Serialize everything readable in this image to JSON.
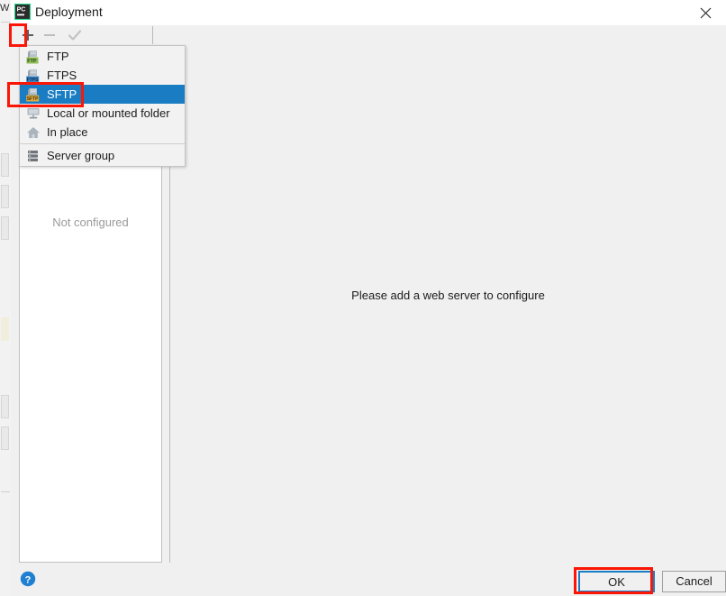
{
  "background_window": {
    "visible_text": "W"
  },
  "dialog": {
    "title": "Deployment",
    "app_icon": "phpstorm-pc-icon",
    "close_icon": "close-icon"
  },
  "toolbar": {
    "buttons": [
      {
        "name": "add-server-button",
        "icon": "plus-icon",
        "label": "+",
        "enabled": true,
        "highlighted": true
      },
      {
        "name": "remove-server-button",
        "icon": "minus-icon",
        "label": "−",
        "enabled": false
      },
      {
        "name": "use-as-default-button",
        "icon": "check-icon",
        "label": "✓",
        "enabled": false
      }
    ]
  },
  "left_panel": {
    "empty_text": "Not configured"
  },
  "popup_menu": {
    "items": [
      {
        "label": "FTP",
        "icon": "ftp-server-icon",
        "icon_label": "FTP",
        "icon_color": "#7cb342",
        "selected": false
      },
      {
        "label": "FTPS",
        "icon": "ftps-server-icon",
        "icon_label": "FTPS",
        "icon_color": "#2a7fc9",
        "selected": false
      },
      {
        "label": "SFTP",
        "icon": "sftp-server-icon",
        "icon_label": "SFTP",
        "icon_color": "#d9a334",
        "selected": true
      },
      {
        "label": "Local or mounted folder",
        "icon": "monitor-icon",
        "icon_label": "",
        "icon_color": "#9aa5ad",
        "selected": false
      },
      {
        "label": "In place",
        "icon": "home-icon",
        "icon_label": "",
        "icon_color": "#9aa5ad",
        "selected": false
      },
      {
        "label": "Server group",
        "icon": "server-group-icon",
        "icon_label": "",
        "icon_color": "#6e7479",
        "selected": false
      }
    ],
    "separator_before_index": 5
  },
  "main_pane": {
    "message": "Please add a web server to configure"
  },
  "bottom_bar": {
    "help_label": "?",
    "ok_label": "OK",
    "cancel_label": "Cancel"
  },
  "annotations": {
    "color": "#fb1606",
    "targets": [
      "add-server-button",
      "menu-item-sftp",
      "ok-button"
    ]
  },
  "colors": {
    "selection_blue": "#1a7dc4",
    "dialog_background": "#f0f0f0",
    "panel_white": "#ffffff",
    "annotation_red": "#fb1606",
    "help_blue": "#1f7fd0"
  }
}
